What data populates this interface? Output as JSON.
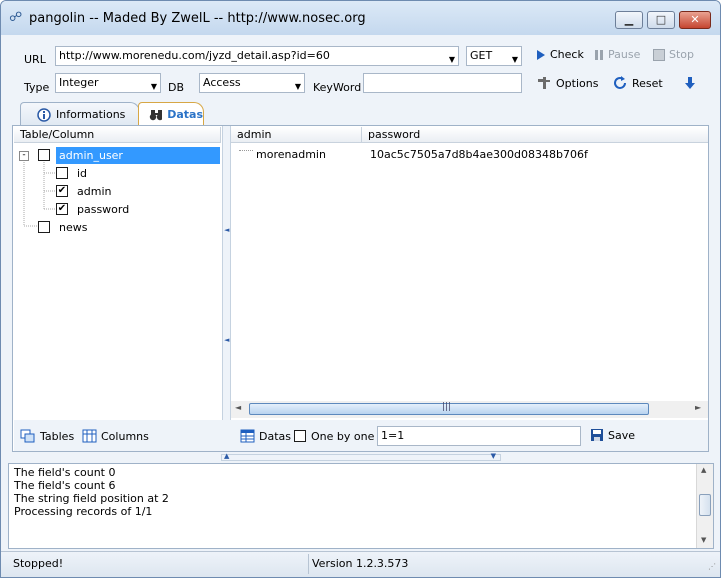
{
  "window": {
    "title": "pangolin -- Maded By ZwelL -- http://www.nosec.org",
    "min_glyph": "▁",
    "max_glyph": "□",
    "close_glyph": "✕"
  },
  "toolbar": {
    "url_label": "URL",
    "url_value": "http://www.morenedu.com/jyzd_detail.asp?id=60",
    "method": "GET",
    "check_label": "Check",
    "pause_label": "Pause",
    "stop_label": "Stop",
    "type_label": "Type",
    "type_value": "Integer",
    "db_label": "DB",
    "db_value": "Access",
    "keyword_label": "KeyWord",
    "keyword_value": "",
    "options_label": "Options",
    "reset_label": "Reset"
  },
  "tabs": [
    {
      "label": "Informations"
    },
    {
      "label": "Datas"
    }
  ],
  "tree": {
    "header": "Table/Column",
    "nodes": [
      {
        "label": "admin_user",
        "checked": false,
        "expanded": true
      },
      {
        "label": "id",
        "checked": false
      },
      {
        "label": "admin",
        "checked": true
      },
      {
        "label": "password",
        "checked": true
      },
      {
        "label": "news",
        "checked": false
      }
    ],
    "tables_label": "Tables",
    "columns_label": "Columns"
  },
  "grid": {
    "columns": [
      "admin",
      "password"
    ],
    "rows": [
      [
        "morenadmin",
        "10ac5c7505a7d8b4ae300d08348b706f"
      ]
    ],
    "datas_label": "Datas",
    "one_by_one_label": "One by one",
    "filter_value": "1=1",
    "save_label": "Save"
  },
  "log": [
    "The field's count 0",
    "The field's count 6",
    "The string field position at 2",
    "Processing records of 1/1"
  ],
  "status": {
    "state": "Stopped!",
    "version": "Version  1.2.3.573"
  },
  "colors": {
    "selection": "#3399ff",
    "active_tab_text": "#2b73c7",
    "accent_blue": "#1f5fbf"
  }
}
